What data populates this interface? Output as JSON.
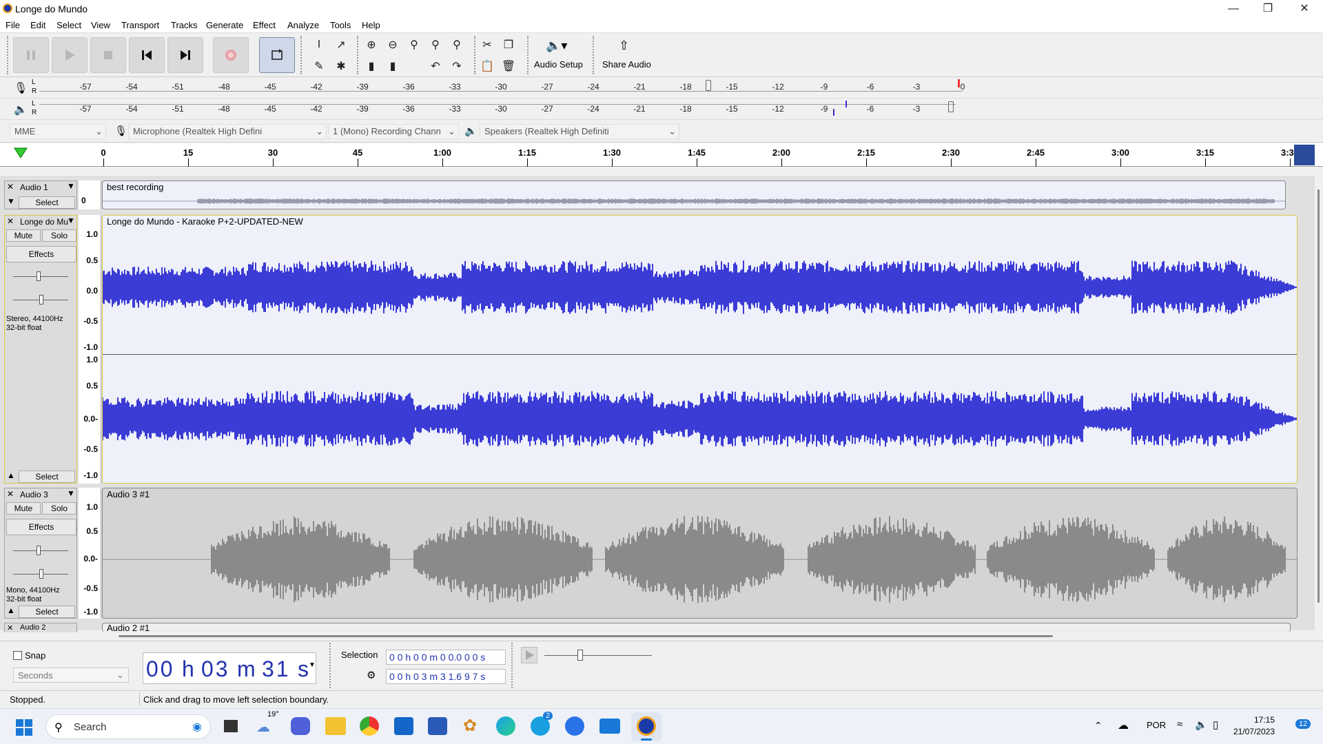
{
  "window": {
    "title": "Longe do Mundo"
  },
  "menu": [
    "File",
    "Edit",
    "Select",
    "View",
    "Transport",
    "Tracks",
    "Generate",
    "Effect",
    "Analyze",
    "Tools",
    "Help"
  ],
  "toolbar": {
    "audio_setup": "Audio Setup",
    "share_audio": "Share Audio"
  },
  "meters": {
    "ticks": [
      "-57",
      "-54",
      "-51",
      "-48",
      "-45",
      "-42",
      "-39",
      "-36",
      "-33",
      "-30",
      "-27",
      "-24",
      "-21",
      "-18",
      "-15",
      "-12",
      "-9",
      "-6",
      "-3",
      "0"
    ],
    "record_lr": [
      "L",
      "R"
    ],
    "play_lr": [
      "L",
      "R"
    ]
  },
  "devices": {
    "host": "MME",
    "mic": "Microphone (Realtek High Defini",
    "channels": "1 (Mono) Recording Chann",
    "speaker": "Speakers (Realtek High Definiti"
  },
  "ruler": [
    "0",
    "15",
    "30",
    "45",
    "1:00",
    "1:15",
    "1:30",
    "1:45",
    "2:00",
    "2:15",
    "2:30",
    "2:45",
    "3:00",
    "3:15",
    "3:30"
  ],
  "tracks": [
    {
      "name": "Audio 1",
      "select": "Select",
      "clip": "best recording",
      "scale": [
        "0"
      ]
    },
    {
      "name": "Longe do Mu",
      "mute": "Mute",
      "solo": "Solo",
      "effects": "Effects",
      "info1": "Stereo, 44100Hz",
      "info2": "32-bit float",
      "select": "Select",
      "clip": "Longe do Mundo - Karaoke P+2-UPDATED-NEW",
      "scale": [
        "1.0",
        "0.5",
        "0.0",
        "-0.5",
        "-1.0"
      ],
      "scale2": [
        "1.0",
        "0.5",
        "0.0-",
        "-0.5",
        "-1.0"
      ]
    },
    {
      "name": "Audio 3",
      "mute": "Mute",
      "solo": "Solo",
      "effects": "Effects",
      "info1": "Mono, 44100Hz",
      "info2": "32-bit float",
      "select": "Select",
      "clip": "Audio 3 #1",
      "scale": [
        "1.0",
        "0.5",
        "0.0-",
        "-0.5",
        "-1.0"
      ]
    },
    {
      "name": "Audio 2",
      "clip": "Audio 2 #1"
    }
  ],
  "bottom": {
    "snap": "Snap",
    "seconds": "Seconds",
    "time": {
      "h": "00",
      "m": "03",
      "s": "31",
      "hu": "h",
      "mu": "m",
      "su": "s"
    },
    "selection_label": "Selection",
    "sel_start": "0 0 h 0 0 m 0 0.0 0 0 s",
    "sel_end": "0 0 h 0 3 m 3 1.6 9 7 s"
  },
  "status": {
    "left": "Stopped.",
    "msg": "Click and drag to move left selection boundary."
  },
  "taskbar": {
    "search": "Search",
    "weather": "19°",
    "lang": "POR",
    "time": "17:15",
    "date": "21/07/2023",
    "badge": "12",
    "skype_badge": "2"
  },
  "colors": {
    "wave_blue": "#3b3bd6",
    "wave_gray": "#8a8a8a",
    "clip_bg": "#eef0fa",
    "gray_bg": "#d4d4d4"
  }
}
